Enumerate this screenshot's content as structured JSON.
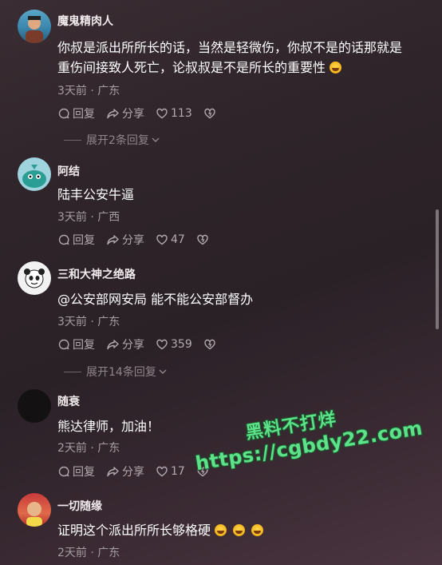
{
  "comments": [
    {
      "user": "魔鬼精肉人",
      "lines": [
        "你叔是派出所所长的话，当然是轻微伤，你叔不是的话那就是",
        "重伤间接致人死亡，论叔叔是不是所长的重要性"
      ],
      "time": "3天前 · 广东",
      "reply": "回复",
      "share": "分享",
      "likes": "113",
      "replies_label": "展开2条回复"
    },
    {
      "user": "阿结",
      "lines": [
        "陆丰公安牛逼"
      ],
      "time": "3天前 · 广西",
      "reply": "回复",
      "share": "分享",
      "likes": "47"
    },
    {
      "user": "三和大神之绝路",
      "lines": [
        "@公安部网安局 能不能公安部督办"
      ],
      "time": "3天前 · 广东",
      "reply": "回复",
      "share": "分享",
      "likes": "359",
      "replies_label": "展开14条回复"
    },
    {
      "user": "随衰",
      "lines": [
        "熊达律师，加油！"
      ],
      "time": "2天前 · 广东",
      "reply": "回复",
      "share": "分享",
      "likes": "17"
    },
    {
      "user": "一切随缘",
      "lines": [
        "证明这个派出所所长够格硬"
      ],
      "time": "2天前 · 广东"
    }
  ],
  "watermark": {
    "line1": "黑料不打烊",
    "line2": "https://cgbdy22.com"
  },
  "colors": {
    "watermark_green": "#5de28a",
    "meta_gray": "#a59ca1"
  },
  "icons": [
    "reply-icon",
    "share-icon",
    "heart-icon",
    "dislike-heart-icon",
    "chevron-down-icon",
    "laugh-emoji-icon"
  ]
}
